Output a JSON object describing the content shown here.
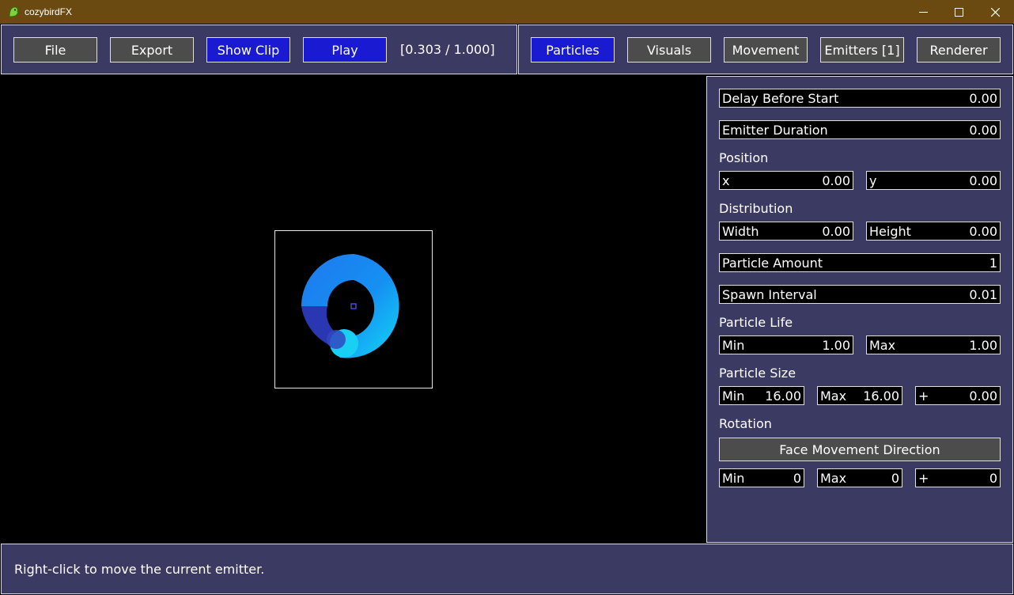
{
  "window": {
    "title": "cozybirdFX",
    "minimize_icon": "minimize-icon",
    "maximize_icon": "maximize-icon",
    "close_icon": "close-icon"
  },
  "toolbar_left": {
    "file": "File",
    "export": "Export",
    "show_clip": "Show Clip",
    "play": "Play",
    "time": "[0.303 / 1.000]"
  },
  "toolbar_right": {
    "particles": "Particles",
    "visuals": "Visuals",
    "movement": "Movement",
    "emitters": "Emitters [1]",
    "renderer": "Renderer"
  },
  "panel": {
    "delay_before_start": {
      "label": "Delay Before Start",
      "value": "0.00"
    },
    "emitter_duration": {
      "label": "Emitter Duration",
      "value": "0.00"
    },
    "position": {
      "heading": "Position",
      "x": {
        "label": "x",
        "value": "0.00"
      },
      "y": {
        "label": "y",
        "value": "0.00"
      }
    },
    "distribution": {
      "heading": "Distribution",
      "width": {
        "label": "Width",
        "value": "0.00"
      },
      "height": {
        "label": "Height",
        "value": "0.00"
      }
    },
    "particle_amount": {
      "label": "Particle Amount",
      "value": "1"
    },
    "spawn_interval": {
      "label": "Spawn Interval",
      "value": "0.01"
    },
    "particle_life": {
      "heading": "Particle Life",
      "min": {
        "label": "Min",
        "value": "1.00"
      },
      "max": {
        "label": "Max",
        "value": "1.00"
      }
    },
    "particle_size": {
      "heading": "Particle Size",
      "min": {
        "label": "Min",
        "value": "16.00"
      },
      "max": {
        "label": "Max",
        "value": "16.00"
      },
      "plus": {
        "label": "+",
        "value": "0.00"
      }
    },
    "rotation": {
      "heading": "Rotation",
      "face_movement": "Face Movement Direction",
      "min": {
        "label": "Min",
        "value": "0"
      },
      "max": {
        "label": "Max",
        "value": "0"
      },
      "plus": {
        "label": "+",
        "value": "0"
      }
    }
  },
  "status": {
    "text": "Right-click to move the current emitter."
  },
  "colors": {
    "panel_bg": "#3b3a63",
    "active_button": "#1a1ad2",
    "button": "#4c4c4c",
    "titlebar": "#6b4a12",
    "particle_start": "#3a2bb8",
    "particle_end": "#19d8f5"
  }
}
